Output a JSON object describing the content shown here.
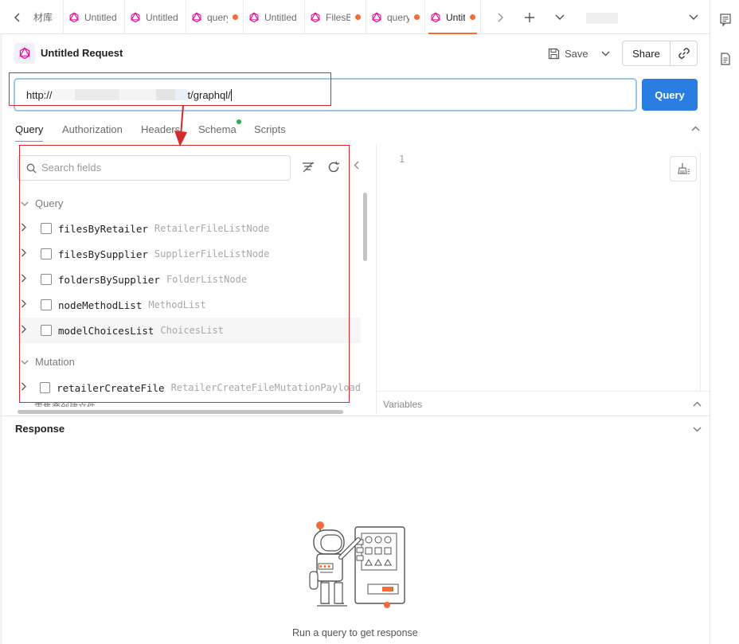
{
  "tabs": [
    {
      "label": "材库",
      "icon": "none",
      "unsaved": false,
      "active": false
    },
    {
      "label": "Untitled",
      "icon": "graphql-icon",
      "unsaved": false,
      "active": false
    },
    {
      "label": "Untitled",
      "icon": "graphql-icon",
      "unsaved": false,
      "active": false
    },
    {
      "label": "query",
      "icon": "graphql-icon",
      "unsaved": true,
      "active": false
    },
    {
      "label": "Untitled",
      "icon": "graphql-icon",
      "unsaved": false,
      "active": false
    },
    {
      "label": "FilesBy",
      "icon": "graphql-icon",
      "unsaved": true,
      "active": false
    },
    {
      "label": "query",
      "icon": "graphql-icon",
      "unsaved": true,
      "active": false
    },
    {
      "label": "Untitled",
      "icon": "graphql-icon",
      "unsaved": true,
      "active": true
    }
  ],
  "header": {
    "title": "Untitled Request",
    "save_label": "Save",
    "share_label": "Share"
  },
  "url": {
    "prefix": "http://",
    "suffix": "t/graphql/"
  },
  "query_button": "Query",
  "subtabs": [
    "Query",
    "Authorization",
    "Headers",
    "Schema",
    "Scripts"
  ],
  "explorer": {
    "search_placeholder": "Search fields",
    "query_section": "Query",
    "query_fields": [
      {
        "name": "filesByRetailer",
        "type": "RetailerFileListNode"
      },
      {
        "name": "filesBySupplier",
        "type": "SupplierFileListNode"
      },
      {
        "name": "foldersBySupplier",
        "type": "FolderListNode"
      },
      {
        "name": "nodeMethodList",
        "type": "MethodList"
      },
      {
        "name": "modelChoicesList",
        "type": "ChoicesList"
      }
    ],
    "mutation_section": "Mutation",
    "mutation_fields": [
      {
        "name": "retailerCreateFile",
        "type": "RetailerCreateFileMutationPayload"
      }
    ],
    "cut_off_text": "零售商创建文件"
  },
  "editor": {
    "line_number": "1",
    "variables_label": "Variables"
  },
  "response": {
    "title": "Response",
    "empty_message": "Run a query to get response"
  },
  "colors": {
    "accent_orange": "#f26b3a",
    "primary_blue": "#2a7de1",
    "graphql_pink": "#e10098",
    "annotation_red": "#d42a2a",
    "schema_dot_green": "#2cb04e"
  }
}
